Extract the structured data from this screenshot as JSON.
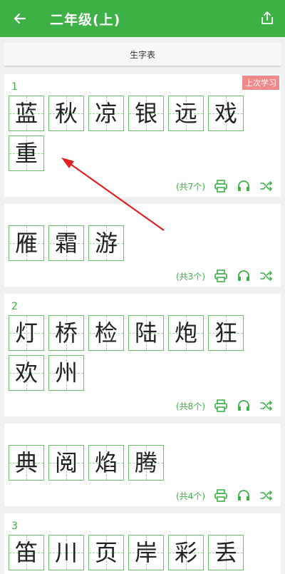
{
  "header": {
    "title": "二年级(上)"
  },
  "subbar": {
    "label": "生字表"
  },
  "cards": [
    {
      "num": "1",
      "tag": "上次学习",
      "chars": [
        "蓝",
        "秋",
        "凉",
        "银",
        "远",
        "戏",
        "重"
      ],
      "count": "(共7个)"
    },
    {
      "num": "",
      "chars": [
        "雁",
        "霜",
        "游"
      ],
      "count": "(共3个)"
    },
    {
      "num": "2",
      "chars": [
        "灯",
        "桥",
        "检",
        "陆",
        "炮",
        "狂",
        "欢",
        "州"
      ],
      "count": "(共8个)"
    },
    {
      "num": "",
      "chars": [
        "典",
        "阅",
        "焰",
        "腾"
      ],
      "count": "(共4个)"
    },
    {
      "num": "3",
      "chars": [
        "笛",
        "川",
        "页",
        "岸",
        "彩",
        "丢"
      ],
      "count": ""
    }
  ],
  "icons": {
    "back": "back-arrow-icon",
    "share": "share-icon",
    "print": "print-icon",
    "listen": "headphones-icon",
    "shuffle": "shuffle-icon"
  },
  "colors": {
    "accent": "#3db046",
    "tag": "#f08a8a",
    "annotation_arrow": "#e02020"
  }
}
